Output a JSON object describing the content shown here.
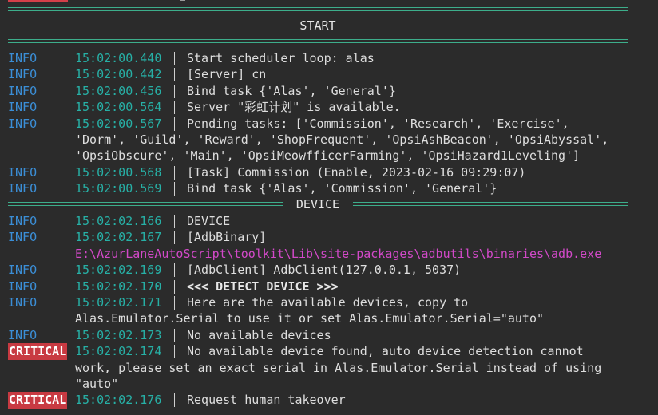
{
  "sections": {
    "start": "START",
    "device": "DEVICE"
  },
  "logs": [
    {
      "level": "INFO",
      "time": "15:02:00.440",
      "message": "Start scheduler loop: alas"
    },
    {
      "level": "INFO",
      "time": "15:02:00.442",
      "message": "[Server] cn"
    },
    {
      "level": "INFO",
      "time": "15:02:00.456",
      "message": "Bind task {'Alas', 'General'}"
    },
    {
      "level": "INFO",
      "time": "15:02:00.564",
      "message": "Server \"彩虹计划\" is available."
    },
    {
      "level": "INFO",
      "time": "15:02:00.567",
      "message": "Pending tasks: ['Commission', 'Research', 'Exercise',",
      "continuation": [
        "'Dorm', 'Guild', 'Reward', 'ShopFrequent', 'OpsiAshBeacon', 'OpsiAbyssal',",
        "'OpsiObscure', 'Main', 'OpsiMeowfficerFarming', 'OpsiHazard1Leveling']"
      ]
    },
    {
      "level": "INFO",
      "time": "15:02:00.568",
      "message": "[Task] Commission (Enable, 2023-02-16 09:29:07)"
    },
    {
      "level": "INFO",
      "time": "15:02:00.569",
      "message": "Bind task {'Alas', 'Commission', 'General'}"
    },
    {
      "level": "INFO",
      "time": "15:02:02.166",
      "message": "DEVICE"
    },
    {
      "level": "INFO",
      "time": "15:02:02.167",
      "message": "[AdbBinary]",
      "continuation": [
        "E:\\AzurLaneAutoScript\\toolkit\\Lib\\site-packages\\adbutils\\binaries\\adb.exe"
      ]
    },
    {
      "level": "INFO",
      "time": "15:02:02.169",
      "message": "[AdbClient] AdbClient(127.0.0.1, 5037)"
    },
    {
      "level": "INFO",
      "time": "15:02:02.170",
      "message": "<<< DETECT DEVICE >>>"
    },
    {
      "level": "INFO",
      "time": "15:02:02.171",
      "message": "Here are the available devices, copy to",
      "continuation": [
        "Alas.Emulator.Serial to use it or set Alas.Emulator.Serial=\"auto\""
      ]
    },
    {
      "level": "INFO",
      "time": "15:02:02.173",
      "message": "No available devices"
    },
    {
      "level": "CRITICAL",
      "time": "15:02:02.174",
      "message": "No available device found, auto device detection cannot",
      "continuation": [
        "work, please set an exact serial in Alas.Emulator.Serial instead of using",
        "\"auto\""
      ]
    },
    {
      "level": "CRITICAL",
      "time": "15:02:02.176",
      "message": "Request human takeover"
    }
  ],
  "colors": {
    "background": "#2b2b2b",
    "info": "#3b8ed6",
    "timestamp": "#27b0a6",
    "critical_bg": "#c83a42",
    "separator": "#3dae8b",
    "path": "#d249c8"
  }
}
